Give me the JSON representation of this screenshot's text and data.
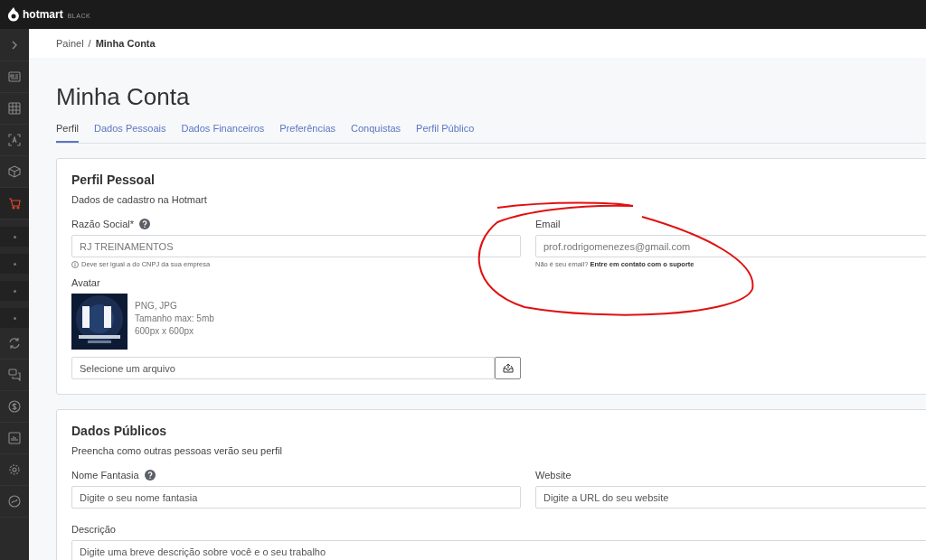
{
  "topbar": {
    "brand": "hotmart",
    "brand_tag": "BLACK"
  },
  "sidebar": {
    "items": [
      {
        "kind": "toggle",
        "selected": false
      },
      {
        "kind": "icon",
        "selected": false
      },
      {
        "kind": "icon",
        "selected": false
      },
      {
        "kind": "icon",
        "selected": false
      },
      {
        "kind": "icon",
        "selected": false
      },
      {
        "kind": "icon",
        "selected": true
      },
      {
        "kind": "subitem",
        "selected": false
      },
      {
        "kind": "subitem",
        "selected": false
      },
      {
        "kind": "subitem",
        "selected": false
      },
      {
        "kind": "subitem",
        "selected": false
      },
      {
        "kind": "icon",
        "selected": false
      },
      {
        "kind": "icon",
        "selected": false
      },
      {
        "kind": "icon",
        "selected": false
      },
      {
        "kind": "icon",
        "selected": false
      },
      {
        "kind": "icon",
        "selected": false
      },
      {
        "kind": "icon",
        "selected": false
      }
    ]
  },
  "breadcrumb": [
    {
      "label": "Painel",
      "current": false
    },
    {
      "label": "Minha Conta",
      "current": true
    }
  ],
  "breadcrumb_separator": "/",
  "page_title": "Minha Conta",
  "tabs": [
    {
      "label": "Perfil",
      "selected": true
    },
    {
      "label": "Dados Pessoais",
      "selected": false
    },
    {
      "label": "Dados Financeiros",
      "selected": false
    },
    {
      "label": "Preferências",
      "selected": false
    },
    {
      "label": "Conquistas",
      "selected": false
    },
    {
      "label": "Perfil Público",
      "selected": false
    }
  ],
  "personal_profile": {
    "title": "Perfil Pessoal",
    "subtitle": "Dados de cadastro na Hotmart",
    "company_name": {
      "label": "Razão Social*",
      "help": true,
      "value": "RJ TREINAMENTOS",
      "hint": "Deve ser igual a do CNPJ da sua empresa"
    },
    "email": {
      "label": "Email",
      "value": "prof.rodrigomenezes@gmail.com",
      "hint": "Não é seu email?",
      "hint_link": "Entre em contato com o suporte"
    },
    "avatar": {
      "label": "Avatar",
      "formats": "PNG, JPG",
      "max_size": "Tamanho max: 5mb",
      "dimensions": "600px x 600px",
      "file_placeholder": "Selecione um arquivo"
    }
  },
  "public_data": {
    "title": "Dados Públicos",
    "subtitle": "Preencha como outras pessoas verão seu perfil",
    "trade_name": {
      "label": "Nome Fantasia",
      "help": true,
      "placeholder": "Digite o seu nome fantasia"
    },
    "website": {
      "label": "Website",
      "placeholder": "Digite a URL do seu website"
    },
    "description": {
      "label": "Descrição",
      "placeholder": "Digite uma breve descrição sobre você e o seu trabalho"
    }
  },
  "annotation": {
    "kind": "circle",
    "color": "#e01010"
  }
}
